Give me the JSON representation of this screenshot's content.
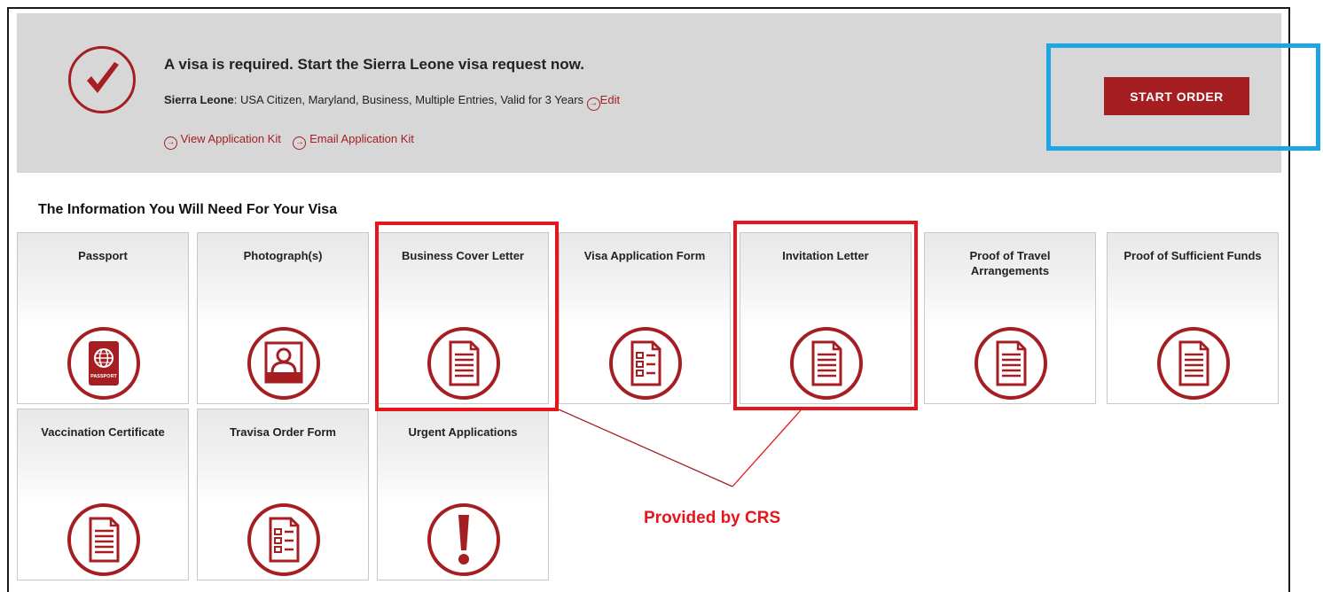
{
  "banner": {
    "title": "A visa is required. Start the Sierra Leone visa request now.",
    "country": "Sierra Leone",
    "details": ": USA Citizen, Maryland, Business, Multiple Entries, Valid for 3 Years",
    "edit_label": "Edit",
    "view_kit_label": "View Application Kit",
    "email_kit_label": "Email Application Kit",
    "start_order_label": "START ORDER"
  },
  "section": {
    "heading": "The Information You Will Need For Your Visa"
  },
  "tiles": [
    {
      "label": "Passport",
      "icon": "passport-icon"
    },
    {
      "label": "Photograph(s)",
      "icon": "photo-icon"
    },
    {
      "label": "Business Cover Letter",
      "icon": "document-icon"
    },
    {
      "label": "Visa Application Form",
      "icon": "form-icon"
    },
    {
      "label": "Invitation Letter",
      "icon": "document-icon"
    },
    {
      "label": "Proof of Travel Arrangements",
      "icon": "document-icon"
    },
    {
      "label": "Proof of Sufficient Funds",
      "icon": "document-icon"
    },
    {
      "label": "Vaccination Certificate",
      "icon": "document-icon"
    },
    {
      "label": "Travisa Order Form",
      "icon": "form-icon"
    },
    {
      "label": "Urgent Applications",
      "icon": "exclamation-icon"
    }
  ],
  "icon_text": {
    "passport": "PASSPORT"
  },
  "annotation": {
    "callout": "Provided by CRS"
  },
  "colors": {
    "brand_red": "#a51e22",
    "highlight_red": "#e8141b",
    "highlight_blue": "#1ea6e4",
    "banner_gray": "#d7d7d7"
  }
}
